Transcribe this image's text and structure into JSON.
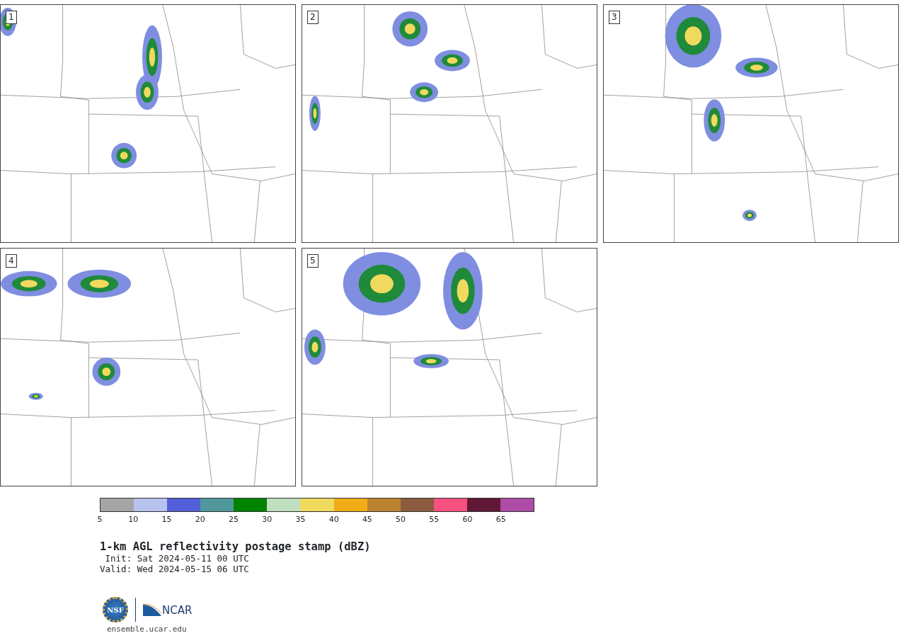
{
  "panels": [
    {
      "label": "1"
    },
    {
      "label": "2"
    },
    {
      "label": "3"
    },
    {
      "label": "4"
    },
    {
      "label": "5"
    }
  ],
  "colorbar": {
    "segments": [
      {
        "color": "#a5a5a5"
      },
      {
        "color": "#b8c2ee"
      },
      {
        "color": "#525fd8"
      },
      {
        "color": "#4f979b"
      },
      {
        "color": "#018200"
      },
      {
        "color": "#bfdfbf"
      },
      {
        "color": "#f0da5e"
      },
      {
        "color": "#f1ad18"
      },
      {
        "color": "#bb832f"
      },
      {
        "color": "#8c5b3f"
      },
      {
        "color": "#f55280"
      },
      {
        "color": "#611837"
      },
      {
        "color": "#ae4ca6"
      }
    ],
    "ticks": [
      "5",
      "10",
      "15",
      "20",
      "25",
      "30",
      "35",
      "40",
      "45",
      "50",
      "55",
      "60",
      "65"
    ]
  },
  "title": "1-km AGL reflectivity postage stamp (dBZ)",
  "init": " Init: Sat 2024-05-11 00 UTC",
  "valid": "Valid: Wed 2024-05-15 06 UTC",
  "logos": {
    "nsf": "NSF",
    "ncar": "NCAR"
  },
  "footer": "ensemble.ucar.edu"
}
